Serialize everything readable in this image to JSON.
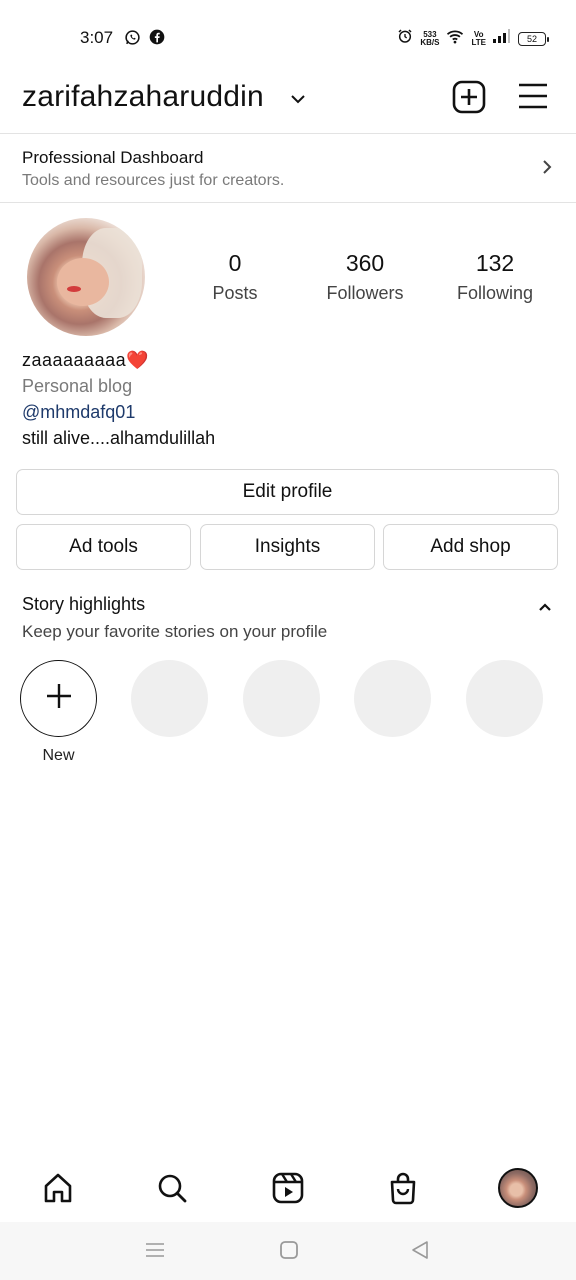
{
  "status_bar": {
    "time": "3:07",
    "left_icons": [
      "whatsapp-icon",
      "facebook-icon"
    ],
    "net_speed_value": "533",
    "net_speed_unit": "KB/S",
    "volte_top": "Vo",
    "volte_bottom": "LTE",
    "battery": "52"
  },
  "header": {
    "username": "zarifahzaharuddin",
    "icons": [
      "chevron-down-icon",
      "add-post-icon",
      "hamburger-menu-icon"
    ]
  },
  "professional_dashboard": {
    "title": "Professional Dashboard",
    "subtitle": "Tools and resources just for creators."
  },
  "profile": {
    "stats": [
      {
        "value": "0",
        "label": "Posts"
      },
      {
        "value": "360",
        "label": "Followers"
      },
      {
        "value": "132",
        "label": "Following"
      }
    ],
    "name": "zaaaaaaaaa",
    "name_emoji": "❤️",
    "category": "Personal blog",
    "link": "@mhmdafq01",
    "bio": "still alive....alhamdulillah"
  },
  "buttons": {
    "edit_profile": "Edit profile",
    "ad_tools": "Ad tools",
    "insights": "Insights",
    "add_shop": "Add shop"
  },
  "highlights": {
    "title": "Story highlights",
    "subtitle": "Keep your favorite stories on your profile",
    "new_label": "New"
  },
  "bottom_nav": [
    "home-icon",
    "search-icon",
    "reels-icon",
    "shop-icon",
    "profile-avatar"
  ],
  "colors": {
    "link": "#1e3a6b",
    "heart": "#e02424",
    "placeholder_circle": "#efefef"
  }
}
